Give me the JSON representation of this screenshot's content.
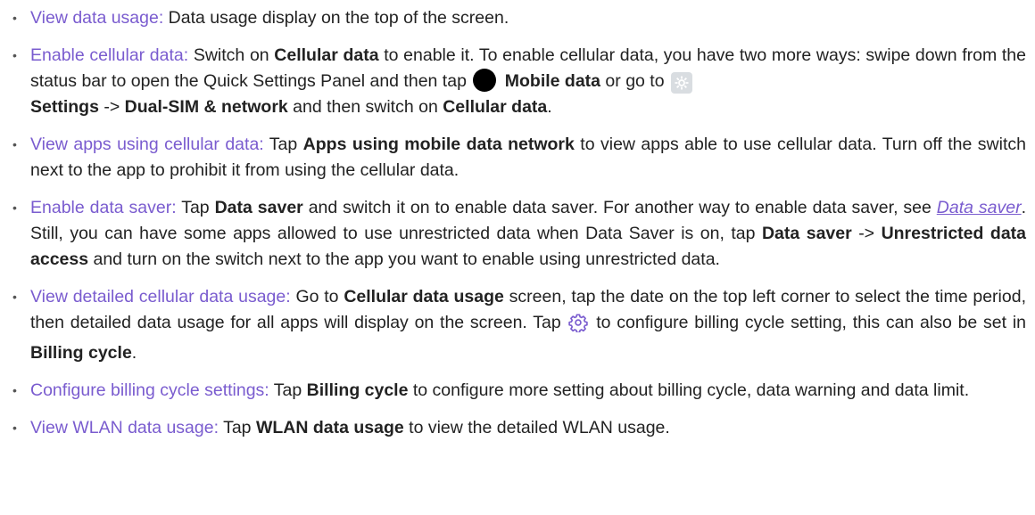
{
  "items": [
    {
      "term": "View data usage:",
      "t1": " Data usage display on the top of the screen."
    },
    {
      "term": "Enable cellular data:",
      "t1": " Switch on ",
      "b1": "Cellular data",
      "t2": " to enable it. To enable cellular data, you have two more ways: swipe down from the status bar to open the Quick Settings Panel and then tap ",
      "b2": "Mobile data",
      "t3": " or go to ",
      "b3": "Settings",
      "t4": " -> ",
      "b4": "Dual-SIM & network",
      "t5": " and then switch on ",
      "b5": "Cellular data",
      "t6": "."
    },
    {
      "term": "View apps using cellular data:",
      "t1": " Tap ",
      "b1": "Apps using mobile data network",
      "t2": " to view apps able to use cellular data. Turn off the switch next to the app to prohibit it from using the cellular data."
    },
    {
      "term": "Enable data saver:",
      "t1": " Tap ",
      "b1": "Data saver",
      "t2": " and switch it on to enable data saver. For another way to enable data saver, see ",
      "link": "Data saver",
      "t3": ". Still, you can have some apps allowed to use unrestricted data when Data Saver is on, tap ",
      "b2": "Data saver",
      "t4": " -> ",
      "b3": "Unrestricted data access",
      "t5": " and turn on the switch next to the app you want to enable using unrestricted data."
    },
    {
      "term": "View detailed cellular data usage:",
      "t1": " Go to ",
      "b1": "Cellular data usage",
      "t2": " screen, tap the date on the top left corner to select the time period, then detailed data usage for all apps will display on the screen. Tap ",
      "t3": " to configure billing cycle setting, this can also be set in ",
      "b2": "Billing cycle",
      "t4": "."
    },
    {
      "term": "Configure billing cycle settings:",
      "t1": " Tap ",
      "b1": "Billing cycle",
      "t2": " to configure more setting about billing cycle, data warning and data limit."
    },
    {
      "term": "View WLAN data usage:",
      "t1": " Tap ",
      "b1": "WLAN data usage",
      "t2": " to view the detailed WLAN usage."
    }
  ],
  "bullet": "•",
  "icons": {
    "mobile_data": "black-circle-icon",
    "settings": "settings-app-icon",
    "gear": "gear-icon"
  },
  "colors": {
    "term": "#7a5ccf",
    "text": "#222222"
  }
}
